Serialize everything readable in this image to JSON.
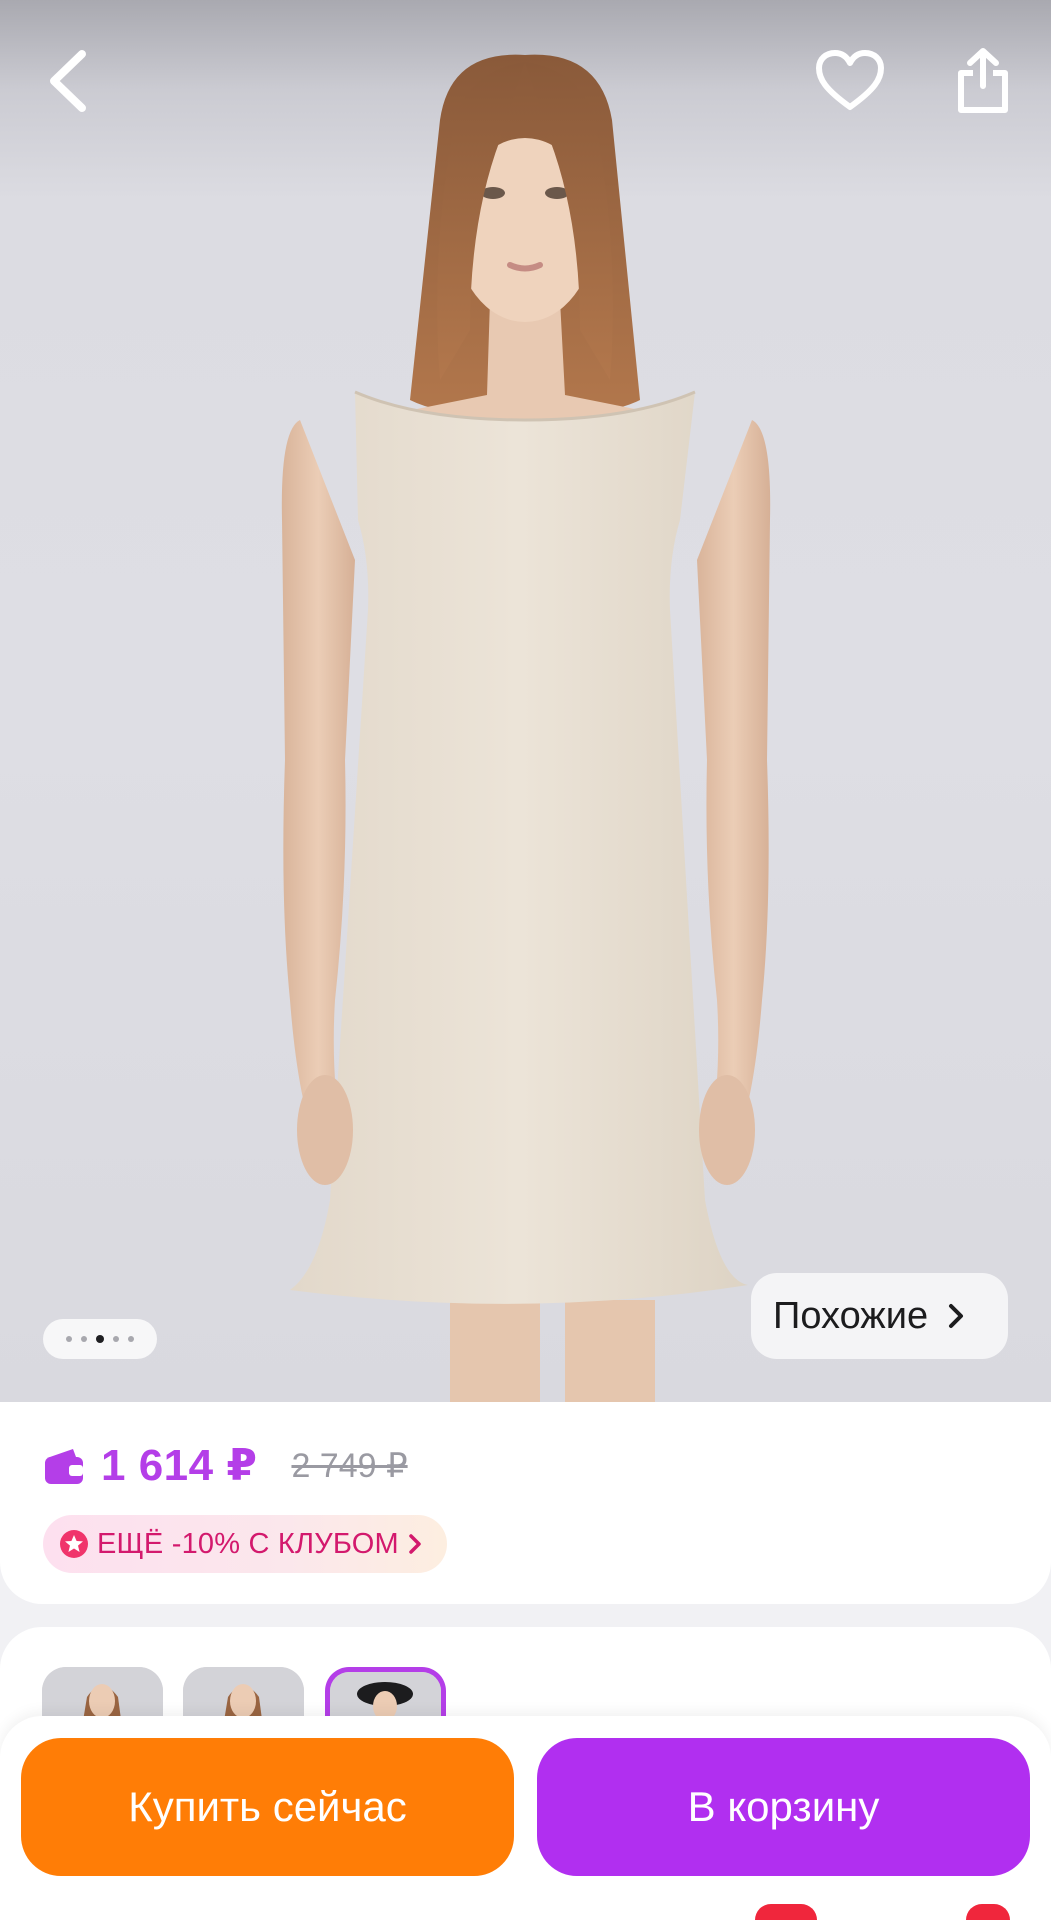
{
  "nav": {
    "back_icon": "chevron-left-icon",
    "favorite_icon": "heart-outline-icon",
    "share_icon": "share-icon"
  },
  "gallery": {
    "dot_count": 5,
    "active_index": 2
  },
  "similar": {
    "label": "Похожие",
    "icon": "chevron-right-icon"
  },
  "price": {
    "current": "1 614 ₽",
    "old": "2 749 ₽",
    "wallet_icon": "wallet-icon"
  },
  "club": {
    "label": "ЕЩЁ -10% С КЛУБОМ",
    "icon": "star-badge-icon"
  },
  "variants": {
    "selected_index": 2
  },
  "actions": {
    "buy_now": "Купить сейчас",
    "add_to_cart": "В корзину"
  },
  "colors": {
    "accent_purple": "#b43ee8",
    "buy_orange": "#ff7d06",
    "cart_purple": "#b12ff0",
    "club_pink": "#d3196d"
  }
}
